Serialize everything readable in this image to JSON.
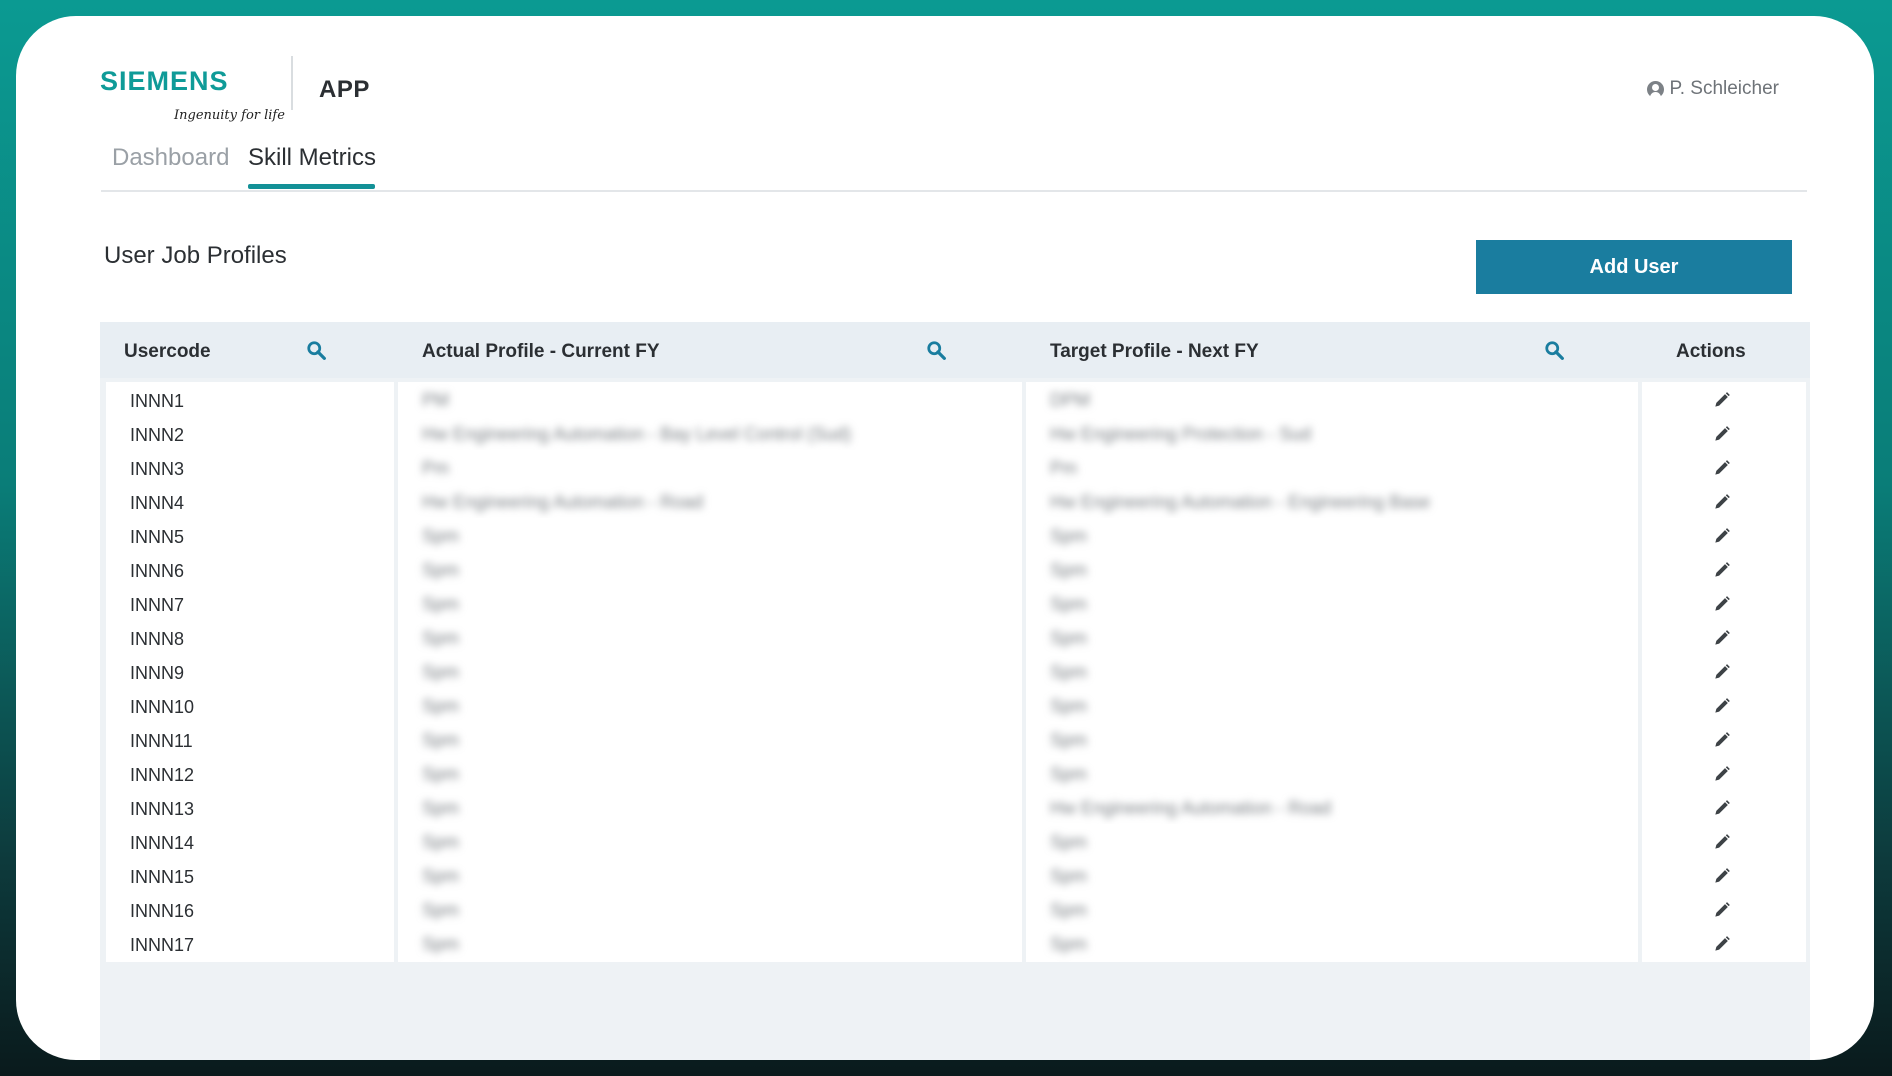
{
  "header": {
    "brand": "SIEMENS",
    "tagline": "Ingenuity for life",
    "app_title": "APP",
    "user_name": "P. Schleicher"
  },
  "tabs": [
    {
      "label": "Dashboard",
      "active": false
    },
    {
      "label": "Skill Metrics",
      "active": true
    }
  ],
  "section": {
    "title": "User Job Profiles",
    "add_button": "Add User"
  },
  "table": {
    "columns": [
      "Usercode",
      "Actual Profile - Current FY",
      "Target Profile - Next FY",
      "Actions"
    ],
    "rows": [
      {
        "usercode": "INNN1",
        "actual": "PM",
        "target": "DPM"
      },
      {
        "usercode": "INNN2",
        "actual": "Hw Engineering Automation - Bay Level Control (Sud)",
        "target": "Hw Engineering Protection - Sud"
      },
      {
        "usercode": "INNN3",
        "actual": "Pm",
        "target": "Pm"
      },
      {
        "usercode": "INNN4",
        "actual": "Hw Engineering Automation - Road",
        "target": "Hw Engineering Automation - Engineering Base"
      },
      {
        "usercode": "INNN5",
        "actual": "Spm",
        "target": "Spm"
      },
      {
        "usercode": "INNN6",
        "actual": "Spm",
        "target": "Spm"
      },
      {
        "usercode": "INNN7",
        "actual": "Spm",
        "target": "Spm"
      },
      {
        "usercode": "INNN8",
        "actual": "Spm",
        "target": "Spm"
      },
      {
        "usercode": "INNN9",
        "actual": "Spm",
        "target": "Spm"
      },
      {
        "usercode": "INNN10",
        "actual": "Spm",
        "target": "Spm"
      },
      {
        "usercode": "INNN11",
        "actual": "Spm",
        "target": "Spm"
      },
      {
        "usercode": "INNN12",
        "actual": "Spm",
        "target": "Spm"
      },
      {
        "usercode": "INNN13",
        "actual": "Spm",
        "target": "Hw Engineering Automation - Road"
      },
      {
        "usercode": "INNN14",
        "actual": "Spm",
        "target": "Spm"
      },
      {
        "usercode": "INNN15",
        "actual": "Spm",
        "target": "Spm"
      },
      {
        "usercode": "INNN16",
        "actual": "Spm",
        "target": "Spm"
      },
      {
        "usercode": "INNN17",
        "actual": "Spm",
        "target": "Spm"
      }
    ]
  },
  "colors": {
    "brand_teal": "#0f9b98",
    "tab_accent": "#139197",
    "button_bg": "#1a7d9f",
    "header_row_bg": "#e8eef3"
  }
}
